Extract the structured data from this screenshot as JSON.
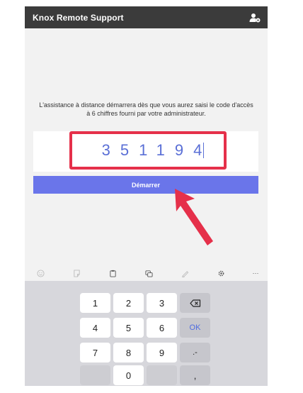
{
  "app": {
    "title": "Knox Remote Support",
    "account_icon": "account-settings-icon"
  },
  "instruction": "L'assistance à distance démarrera dès que vous aurez saisi le code d'accès à 6 chiffres fourni par votre administrateur.",
  "code": {
    "value": "351194"
  },
  "start_button": {
    "label": "Démarrer"
  },
  "colors": {
    "appbar": "#3b3b3b",
    "accent": "#6a75ea",
    "highlight": "#e5304a",
    "code_text": "#5a6fd6"
  },
  "keyboard": {
    "toolbar_icons": [
      "emoji-icon",
      "sticker-icon",
      "clipboard-icon",
      "translate-icon",
      "handwriting-icon",
      "settings-icon",
      "more-icon"
    ],
    "rows": [
      [
        "1",
        "2",
        "3"
      ],
      [
        "4",
        "5",
        "6"
      ],
      [
        "7",
        "8",
        "9"
      ],
      [
        "",
        "0",
        ""
      ]
    ],
    "side_keys": [
      "",
      "OK",
      ".-",
      ","
    ],
    "more_label": "···"
  }
}
